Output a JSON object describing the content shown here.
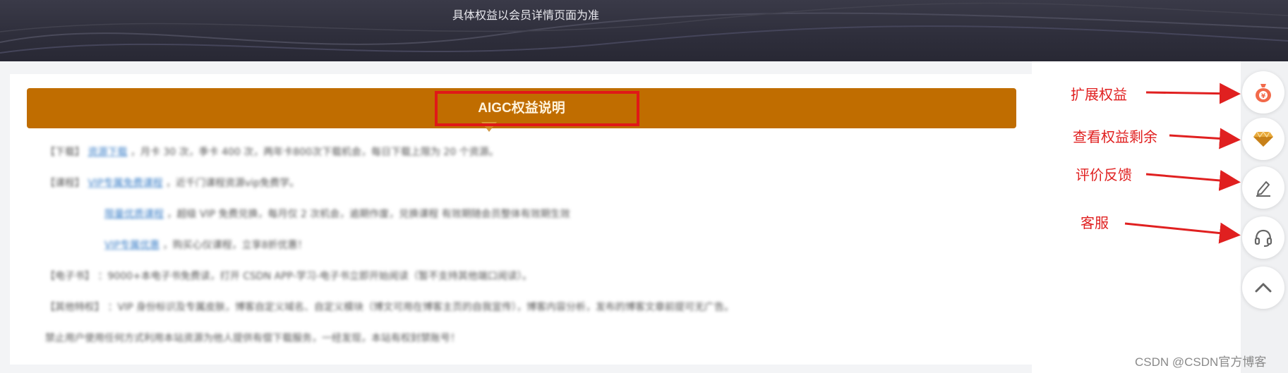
{
  "banner": {
    "note": "具体权益以会员详情页面为准"
  },
  "card": {
    "title": "AIGC权益说明",
    "lines": [
      {
        "label": "【下载】",
        "link": "资源下载",
        "text": "，月卡 30 次，季卡 400 次，两年卡800次下载机会，每日下载上限为 20 个资源。"
      },
      {
        "label": "【课程】",
        "link": "VIP专属免费课程",
        "text": "，近千门课程资源vip免费学。"
      },
      {
        "label": "",
        "link": "限量优质课程",
        "text": "，超级 VIP 免费兑换，每月仅 2 次机会，逾期作废，兑换课程 有效期随会员整体有效期生效"
      },
      {
        "label": "",
        "link": "VIP专属优惠",
        "text": "，购买心仪课程，立享8折优惠！"
      },
      {
        "label": "【电子书】",
        "link": "",
        "text": "：9000+本电子书免费读，打开 CSDN APP-学习-电子书立即开始阅读（暂不支持其他端口阅读）。"
      },
      {
        "label": "【其他特权】",
        "link": "",
        "text": "：VIP 身份标识及专属皮肤，博客自定义域名、自定义模块（博文可用在博客主页的自我宣传），博客内容分析，发布的博客文章前提可无广告。"
      },
      {
        "label": "",
        "link": "",
        "text": "禁止用户使用任何方式利用本站资源为他人提供有偿下载服务，一经发现，本站有权封禁账号！"
      }
    ]
  },
  "annotations": {
    "expand_rights": "扩展权益",
    "view_remaining": "查看权益剩余",
    "feedback": "评价反馈",
    "customer_service": "客服"
  },
  "icons": {
    "money_bag": "money-bag-icon",
    "diamond": "diamond-icon",
    "pencil": "pencil-icon",
    "headset": "headset-icon",
    "chevron_up": "chevron-up-icon"
  },
  "colors": {
    "title_bar": "#c06d00",
    "annotation": "#e02020",
    "banner": "#2f2f3c"
  },
  "watermark": "CSDN @CSDN官方博客"
}
